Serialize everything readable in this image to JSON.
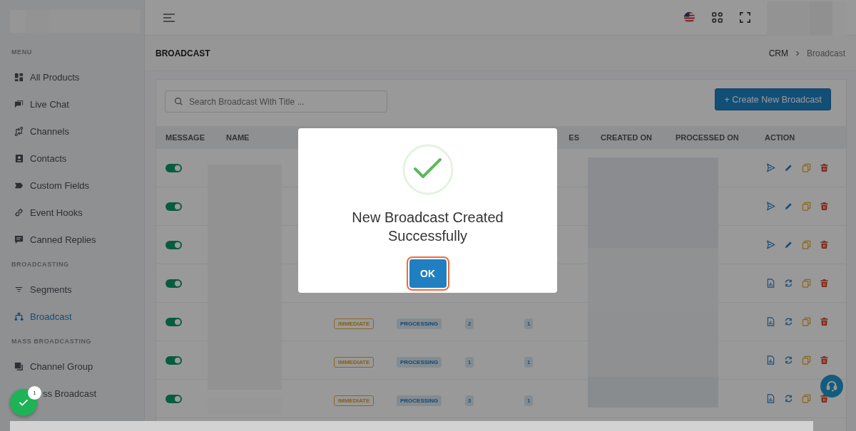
{
  "sidebar": {
    "sections": [
      {
        "title": "MENU",
        "items": [
          {
            "label": "All Products",
            "selected": false
          },
          {
            "label": "Live Chat",
            "selected": false
          },
          {
            "label": "Channels",
            "selected": false
          },
          {
            "label": "Contacts",
            "selected": false
          },
          {
            "label": "Custom Fields",
            "selected": false
          },
          {
            "label": "Event Hooks",
            "selected": false
          },
          {
            "label": "Canned Replies",
            "selected": false
          }
        ]
      },
      {
        "title": "BROADCASTING",
        "items": [
          {
            "label": "Segments",
            "selected": false
          },
          {
            "label": "Broadcast",
            "selected": true
          }
        ]
      },
      {
        "title": "MASS BROADCASTING",
        "items": [
          {
            "label": "Channel Group",
            "selected": false
          },
          {
            "label": "ss Broadcast",
            "selected": false
          }
        ]
      }
    ]
  },
  "page": {
    "title": "BROADCAST",
    "breadcrumb": [
      "CRM",
      "Broadcast"
    ]
  },
  "search": {
    "placeholder": "Search Broadcast With Title ..."
  },
  "create_button": {
    "label": "+ Create New Broadcast"
  },
  "table": {
    "columns": [
      "MESSAGE",
      "NAME",
      "ES",
      "CREATED ON",
      "PROCESSED ON",
      "ACTION"
    ],
    "rows": [
      {
        "kind": "pending",
        "message_on": true
      },
      {
        "kind": "pending",
        "message_on": true
      },
      {
        "kind": "pending",
        "message_on": true
      },
      {
        "kind": "processed",
        "message_on": true
      },
      {
        "kind": "processed",
        "message_on": true,
        "schedule": "IMMEDIATE",
        "status": "PROCESSING",
        "count_1": "2",
        "count_2": "1"
      },
      {
        "kind": "processed",
        "message_on": true,
        "schedule": "IMMEDIATE",
        "status": "PROCESSING",
        "count_1": "1",
        "count_2": "1"
      },
      {
        "kind": "processed",
        "message_on": true,
        "schedule": "IMMEDIATE",
        "status": "PROCESSING",
        "count_1": "3",
        "count_2": "1"
      }
    ]
  },
  "modal": {
    "title": "New Broadcast Created Successfully",
    "button": "OK"
  },
  "notification": {
    "count": "1"
  }
}
